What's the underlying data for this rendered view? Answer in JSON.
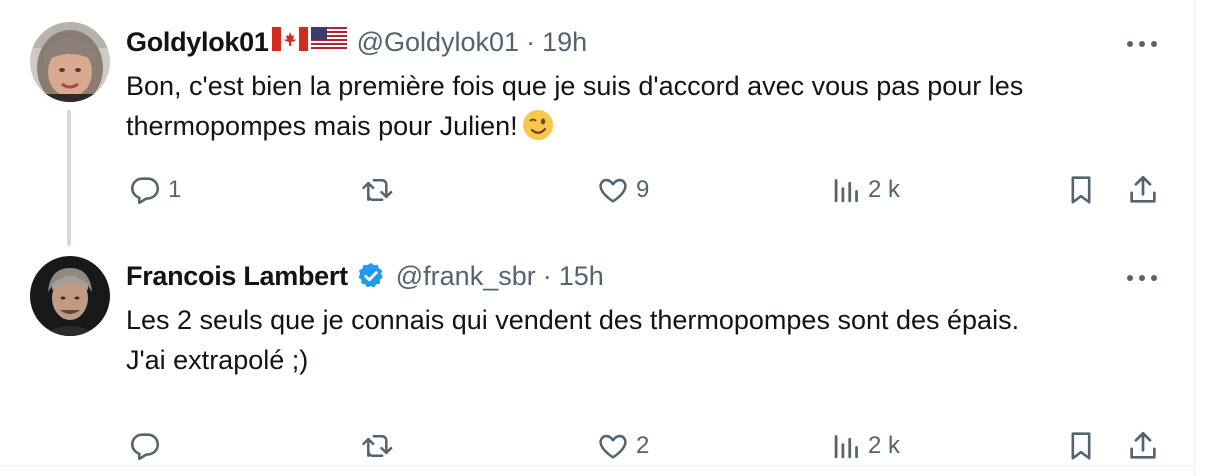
{
  "tweets": [
    {
      "name": "Goldylok01",
      "flags": [
        "canada-flag",
        "usa-flag"
      ],
      "handle": "@Goldylok01",
      "separator": "·",
      "time": "19h",
      "text_lines": [
        "Bon, c'est bien la première fois que je suis d'accord avec vous pas pour les",
        "thermopompes mais pour Julien!"
      ],
      "emoji": "winking-face",
      "verified": false,
      "stats": {
        "replies": "1",
        "retweets": "",
        "likes": "9",
        "views": "2 k"
      }
    },
    {
      "name": "Francois Lambert",
      "handle": "@frank_sbr",
      "separator": "·",
      "time": "15h",
      "text_lines": [
        "Les 2 seuls que je connais qui vendent des thermopompes sont des épais.",
        "J'ai extrapolé ;)"
      ],
      "verified": true,
      "stats": {
        "replies": "",
        "retweets": "",
        "likes": "2",
        "views": "2 k"
      }
    }
  ],
  "icons": {
    "reply": "speech-bubble-icon",
    "retweet": "retweet-arrows-icon",
    "like": "heart-icon",
    "views": "bar-chart-icon",
    "bookmark": "bookmark-icon",
    "share": "share-upload-icon",
    "more": "more-dots-icon",
    "verified": "verified-badge-icon"
  },
  "colors": {
    "text": "#0f1419",
    "secondary": "#536471",
    "verified": "#1d9bf0",
    "thread_line": "#cfd9de",
    "border": "#eff3f4"
  }
}
